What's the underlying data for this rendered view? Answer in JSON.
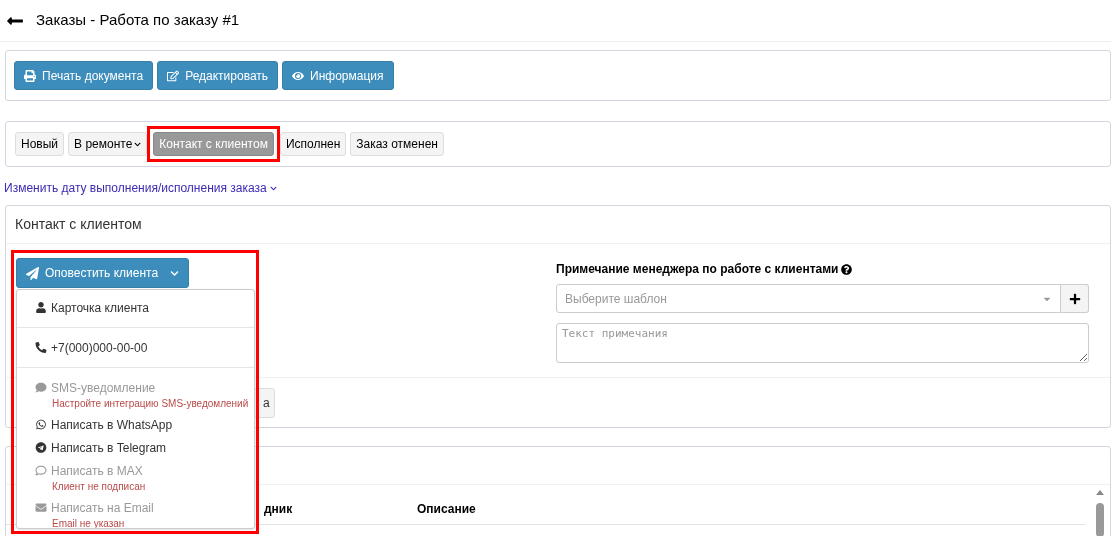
{
  "header": {
    "title": "Заказы - Работа по заказу #1"
  },
  "actions": [
    {
      "label": "Печать документа"
    },
    {
      "label": "Редактировать"
    },
    {
      "label": "Информация"
    }
  ],
  "statuses": [
    {
      "label": "Новый",
      "selected": false,
      "has_menu": false,
      "highlighted": false
    },
    {
      "label": "В ремонте",
      "selected": false,
      "has_menu": true,
      "highlighted": false
    },
    {
      "label": "Контакт с клиентом",
      "selected": true,
      "has_menu": false,
      "highlighted": true
    },
    {
      "label": "Исполнен",
      "selected": false,
      "has_menu": false,
      "highlighted": false
    },
    {
      "label": "Заказ отменен",
      "selected": false,
      "has_menu": false,
      "highlighted": false
    }
  ],
  "date_link": "Изменить дату выполнения/исполнения заказа",
  "contact_panel": {
    "title": "Контакт с клиентом",
    "notify_button": {
      "label": "Оповестить клиента",
      "expanded": true,
      "highlighted": true
    },
    "menu": [
      {
        "kind": "item",
        "label": "Карточка клиента",
        "disabled": false
      },
      {
        "kind": "divider"
      },
      {
        "kind": "item",
        "label": "+7(000)000-00-00",
        "disabled": false
      },
      {
        "kind": "divider"
      },
      {
        "kind": "item",
        "label": "SMS-уведомление",
        "disabled": true,
        "hint": "Настройте интеграцию SMS-уведомлений"
      },
      {
        "kind": "item",
        "label": "Написать в WhatsApp",
        "disabled": false
      },
      {
        "kind": "item",
        "label": "Написать в Telegram",
        "disabled": false
      },
      {
        "kind": "item",
        "label": "Написать в MAX",
        "disabled": true,
        "hint": "Клиент не подписан"
      },
      {
        "kind": "item",
        "label": "Написать на Email",
        "disabled": true,
        "hint": "Email не указан"
      }
    ],
    "note": {
      "label": "Примечание менеджера по работе с клиентами",
      "template_select": {
        "placeholder": "Выберите шаблон"
      },
      "textarea": {
        "placeholder": "Текст примечания"
      }
    },
    "footer_button": "а"
  },
  "history_table": {
    "columns": [
      "дник",
      "Описание"
    ]
  }
}
